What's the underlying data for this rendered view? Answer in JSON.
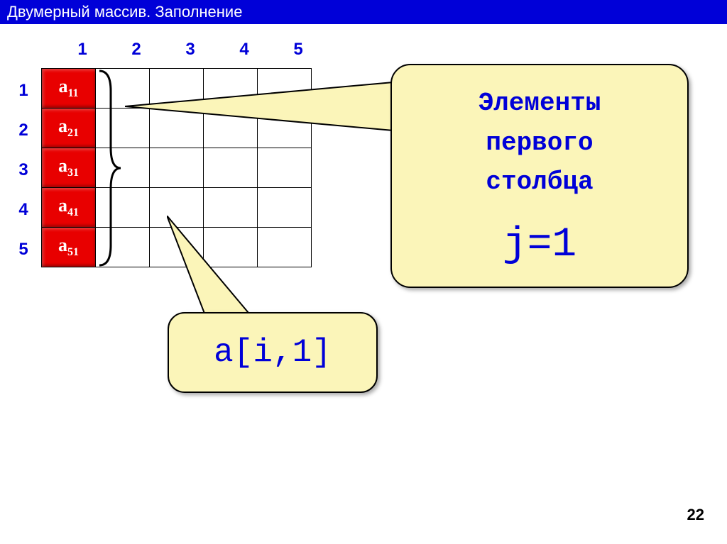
{
  "title": "Двумерный массив. Заполнение",
  "columns": [
    "1",
    "2",
    "3",
    "4",
    "5"
  ],
  "rows": [
    "1",
    "2",
    "3",
    "4",
    "5"
  ],
  "cells": [
    {
      "base": "a",
      "sub": "11"
    },
    {
      "base": "a",
      "sub": "21"
    },
    {
      "base": "a",
      "sub": "31"
    },
    {
      "base": "a",
      "sub": "41"
    },
    {
      "base": "a",
      "sub": "51"
    }
  ],
  "callout1": {
    "line1": "Элементы",
    "line2": "первого",
    "line3": "столбца",
    "equation": "j=1"
  },
  "callout2": {
    "text": "a[i,1]"
  },
  "page": "22"
}
